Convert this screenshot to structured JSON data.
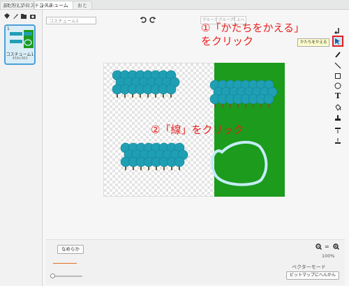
{
  "tabs": [
    {
      "label": "スクリプト",
      "active": false
    },
    {
      "label": "コスチューム",
      "active": true
    },
    {
      "label": "おと",
      "active": false
    }
  ],
  "sidebar": {
    "new_costume_label": "あたらしいコスチューム:",
    "costume": {
      "index": "1",
      "name": "コスチューム1",
      "size": "458x360"
    }
  },
  "editor": {
    "name_placeholder": "コスチューム1",
    "toolbar_top": [
      "グループ",
      "グループ解除",
      "上へ",
      "前へ",
      "後ろへ"
    ],
    "reshape_tooltip": "かたちをかえる",
    "smooth_label": "なめらか",
    "zoom_percent": "100%",
    "mode_label": "ベクターモード",
    "convert_bitmap_label": "ビットマップにへんかん"
  },
  "annotations": {
    "step1_line1": "①「かたちをかえる」",
    "step1_line2": "をクリック",
    "step2": "②「線」をクリック"
  },
  "colors": {
    "annotation": "#e8201e",
    "green_bg": "#1c9b1c",
    "tree": "#1f9fb4",
    "accent": "#4a9fd8"
  }
}
